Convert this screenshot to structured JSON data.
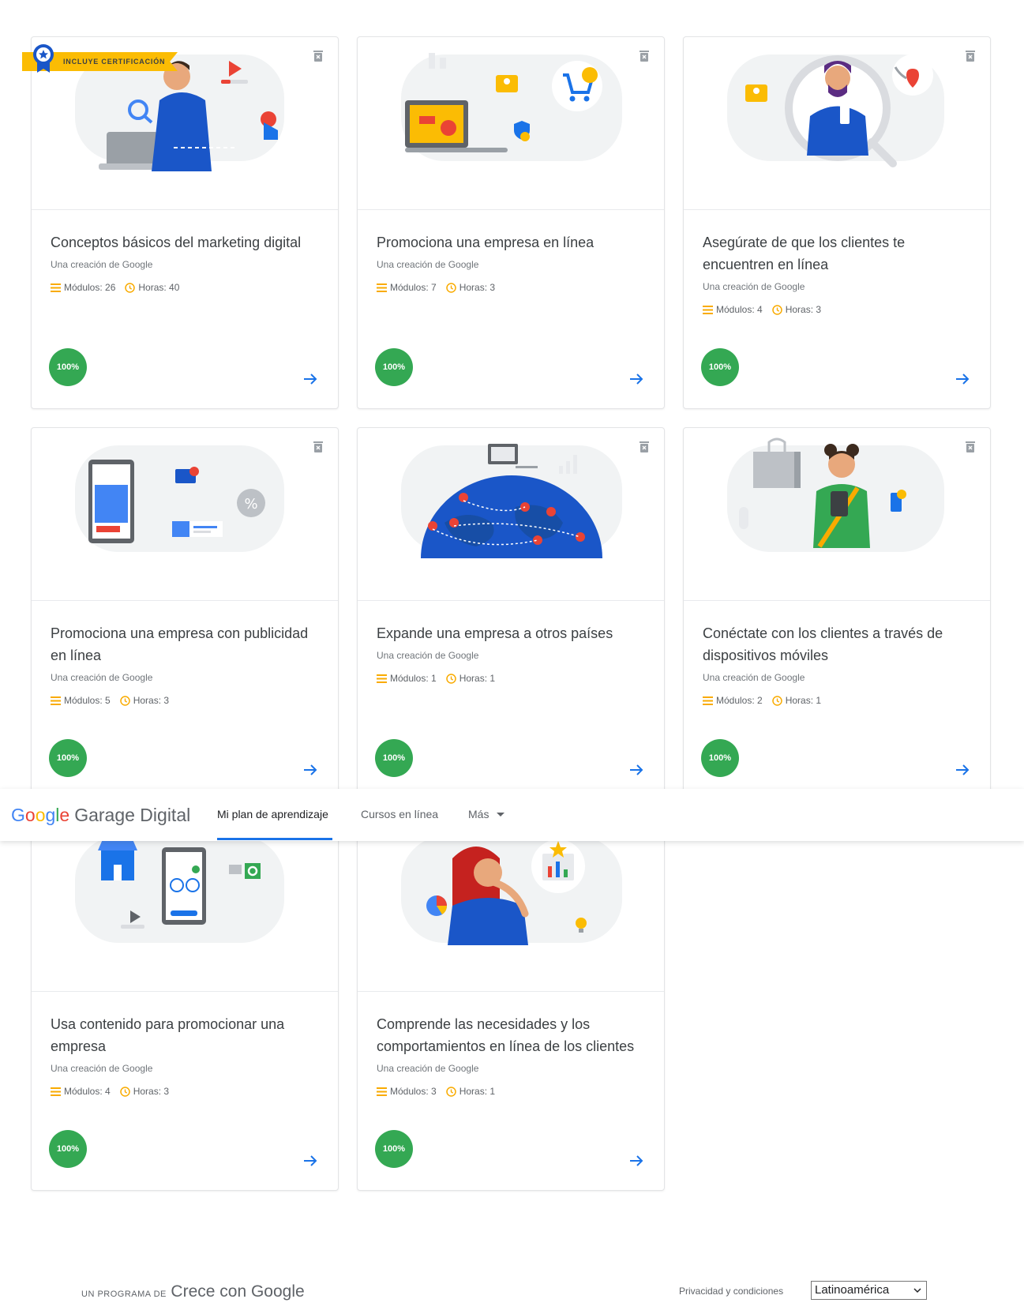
{
  "certification_badge": "INCLUYE CERTIFICACIÓN",
  "cards": [
    {
      "title": "Conceptos básicos del marketing digital",
      "creator": "Una creación de Google",
      "modules": "Módulos: 26",
      "hours": "Horas: 40",
      "progress": "100%"
    },
    {
      "title": "Promociona una empresa en línea",
      "creator": "Una creación de Google",
      "modules": "Módulos: 7",
      "hours": "Horas: 3",
      "progress": "100%"
    },
    {
      "title": "Asegúrate de que los clientes te encuentren en línea",
      "creator": "Una creación de Google",
      "modules": "Módulos: 4",
      "hours": "Horas: 3",
      "progress": "100%"
    },
    {
      "title": "Promociona una empresa con publicidad en línea",
      "creator": "Una creación de Google",
      "modules": "Módulos: 5",
      "hours": "Horas: 3",
      "progress": "100%"
    },
    {
      "title": "Expande una empresa a otros países",
      "creator": "Una creación de Google",
      "modules": "Módulos: 1",
      "hours": "Horas: 1",
      "progress": "100%"
    },
    {
      "title": "Conéctate con los clientes a través de dispositivos móviles",
      "creator": "Una creación de Google",
      "modules": "Módulos: 2",
      "hours": "Horas: 1",
      "progress": "100%"
    },
    {
      "title": "Usa contenido para promocionar una empresa",
      "creator": "Una creación de Google",
      "modules": "Módulos: 4",
      "hours": "Horas: 3",
      "progress": "100%"
    },
    {
      "title": "Comprende las necesidades y los comportamientos en línea de los clientes",
      "creator": "Una creación de Google",
      "modules": "Módulos: 3",
      "hours": "Horas: 1",
      "progress": "100%"
    }
  ],
  "nav": {
    "logo_google": [
      "G",
      "o",
      "o",
      "g",
      "l",
      "e"
    ],
    "logo_product": "Garage Digital",
    "tabs": [
      "Mi plan de aprendizaje",
      "Cursos en línea",
      "Más"
    ]
  },
  "footer": {
    "program_prefix": "UN PROGRAMA DE",
    "program_brand": "Crece con Google",
    "privacy": "Privacidad y condiciones",
    "region": "Latinoamérica"
  },
  "colors": {
    "accent": "#1a73e8",
    "progress": "#34a853",
    "highlight": "#fbbc04"
  }
}
